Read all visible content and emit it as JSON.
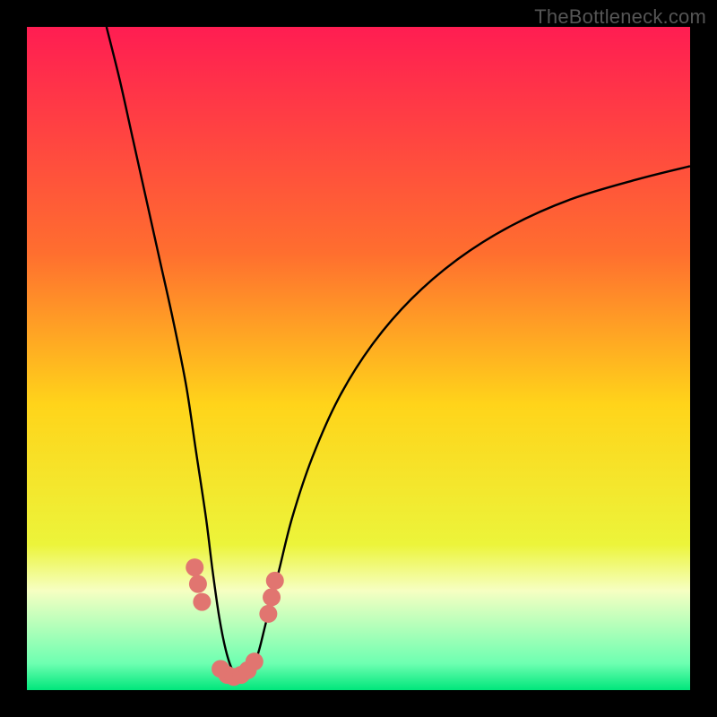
{
  "watermark": "TheBottleneck.com",
  "chart_data": {
    "type": "line",
    "title": "",
    "xlabel": "",
    "ylabel": "",
    "xlim": [
      0,
      100
    ],
    "ylim": [
      0,
      100
    ],
    "background_gradient_stops": [
      {
        "pct": 0,
        "color": "#ff1d52"
      },
      {
        "pct": 34,
        "color": "#ff6e2f"
      },
      {
        "pct": 57,
        "color": "#ffd41a"
      },
      {
        "pct": 78,
        "color": "#ecf43a"
      },
      {
        "pct": 85,
        "color": "#f6ffc2"
      },
      {
        "pct": 96,
        "color": "#6dffb1"
      },
      {
        "pct": 100,
        "color": "#00e67b"
      }
    ],
    "series": [
      {
        "name": "bottleneck-curve",
        "color": "#000000",
        "x": [
          12,
          14,
          16,
          18,
          20,
          22,
          24,
          25.5,
          27,
          28,
          29,
          30,
          31,
          32,
          33,
          34,
          35,
          36,
          38,
          40,
          43,
          47,
          52,
          58,
          65,
          73,
          82,
          92,
          100
        ],
        "y": [
          100,
          92,
          83,
          74,
          65,
          56,
          46,
          36,
          26,
          18,
          11,
          6,
          3,
          2,
          2,
          3,
          6,
          10,
          18,
          26,
          35,
          44,
          52,
          59,
          65,
          70,
          74,
          77,
          79
        ]
      }
    ],
    "markers": {
      "name": "highlight-dots",
      "color": "#e17570",
      "radius": 10,
      "points": [
        {
          "x": 25.3,
          "y": 18.5
        },
        {
          "x": 25.8,
          "y": 16.0
        },
        {
          "x": 26.4,
          "y": 13.3
        },
        {
          "x": 29.2,
          "y": 3.2
        },
        {
          "x": 30.2,
          "y": 2.3
        },
        {
          "x": 31.2,
          "y": 2.0
        },
        {
          "x": 32.3,
          "y": 2.3
        },
        {
          "x": 33.3,
          "y": 3.0
        },
        {
          "x": 34.3,
          "y": 4.3
        },
        {
          "x": 36.4,
          "y": 11.5
        },
        {
          "x": 36.9,
          "y": 14.0
        },
        {
          "x": 37.4,
          "y": 16.5
        }
      ]
    }
  }
}
